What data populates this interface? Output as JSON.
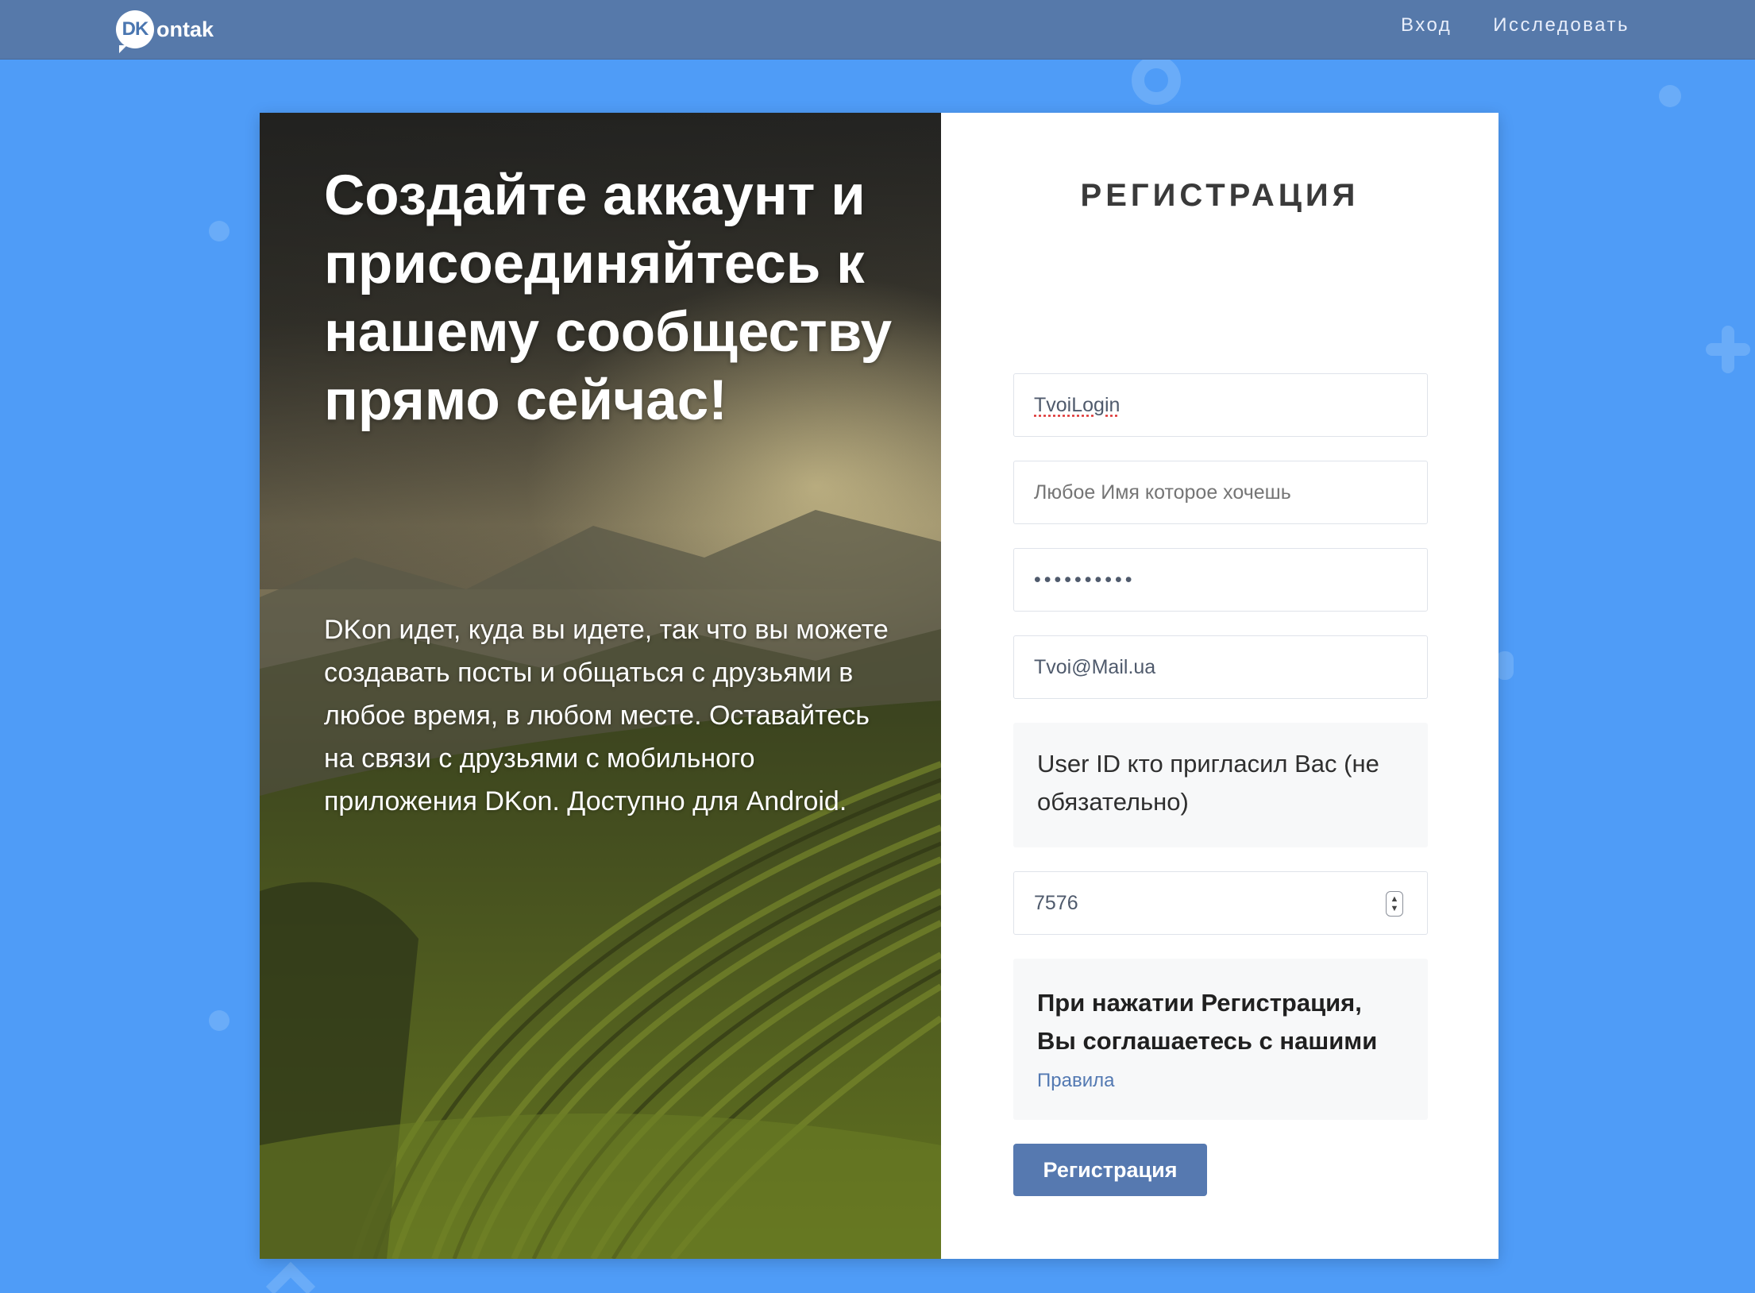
{
  "brand": {
    "logo_mark": "DK",
    "logo_text": "ontak"
  },
  "nav": {
    "login": "Вход",
    "explore": "Исследовать"
  },
  "hero": {
    "title": "Создайте аккаунт и присоединяйтесь к нашему сообществу прямо сейчас!",
    "description": "DKon идет, куда вы идете, так что вы можете создавать посты и общаться с друзьями в любое время, в любом месте. Оставайтесь на связи с друзьями с мобильного приложения DKon. Доступно для Android."
  },
  "form": {
    "title": "РЕГИСТРАЦИЯ",
    "login_value": "TvoiLogin",
    "name_placeholder": "Любое Имя которое хочешь",
    "password_mask": "••••••••••",
    "email_value": "Tvoi@Mail.ua",
    "referrer_label": "User ID кто пригласил Вас (не обязательно)",
    "referrer_value": "7576",
    "terms_text": "При нажатии Регистрация, Вы соглашаетесь с нашими",
    "terms_link": "Правила",
    "submit_label": "Регистрация"
  },
  "colors": {
    "background": "#4f9cf7",
    "topbar": "#5679aa",
    "button": "#5679b0",
    "link": "#5379b2"
  },
  "icons": {
    "spinner": "number-spinner-icon"
  }
}
